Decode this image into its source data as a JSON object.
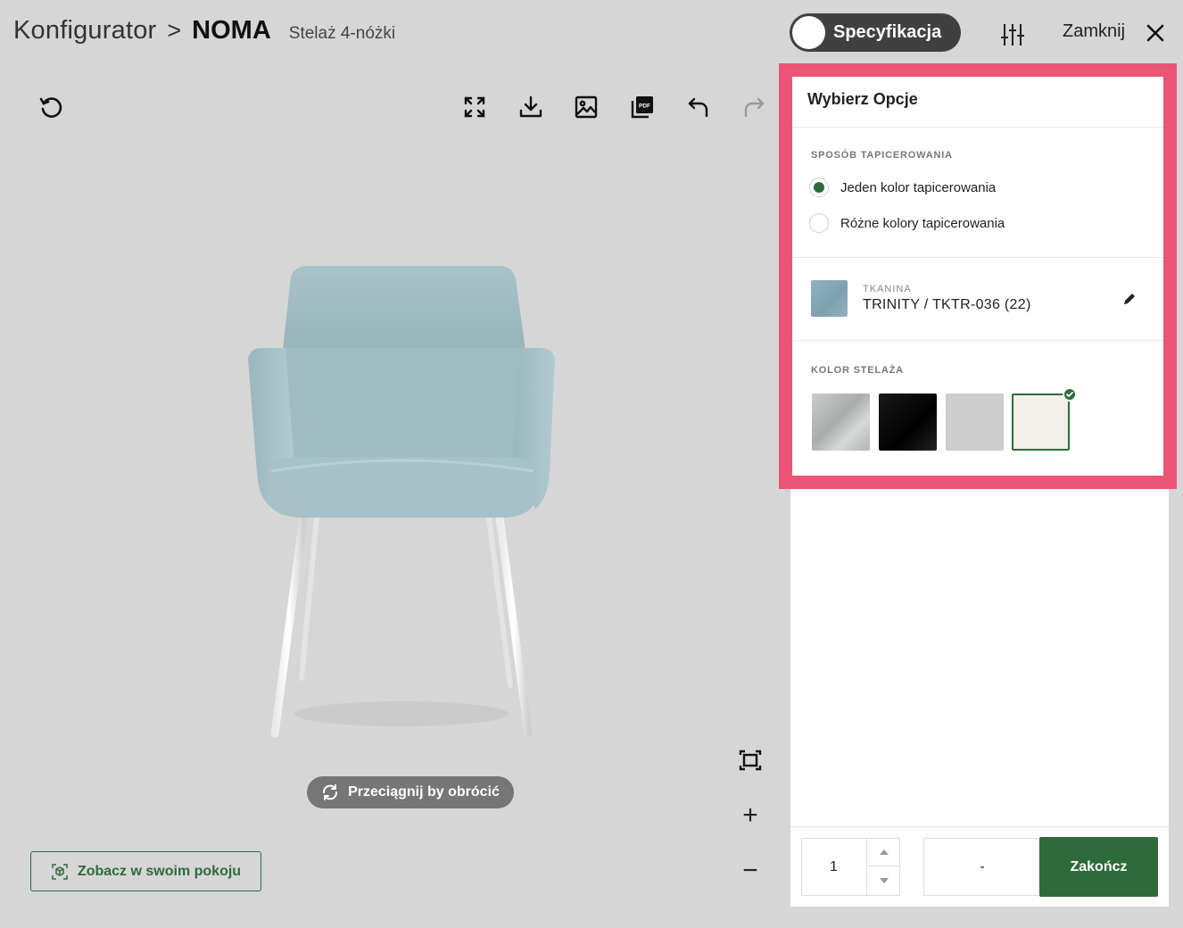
{
  "header": {
    "breadcrumb": "Konfigurator",
    "separator": ">",
    "product": "NOMA",
    "subtitle": "Stelaż 4-nóżki",
    "spec_toggle_label": "Specyfikacja",
    "close_label": "Zamknij"
  },
  "toolbar": {
    "icons": [
      "reset-view-icon",
      "fullscreen-icon",
      "download-icon",
      "image-icon",
      "pdf-icon",
      "undo-icon",
      "redo-icon"
    ]
  },
  "viewer": {
    "drag_hint": "Przeciągnij by obrócić",
    "ar_button": "Zobacz w swoim pokoju",
    "zoom_in": "+",
    "zoom_out": "−"
  },
  "panel": {
    "title": "Wybierz Opcje",
    "upholstery": {
      "label": "SPOSÓB TAPICEROWANIA",
      "options": [
        {
          "label": "Jeden kolor tapicerowania",
          "selected": true
        },
        {
          "label": "Różne kolory tapicerowania",
          "selected": false
        }
      ]
    },
    "fabric": {
      "label": "TKANINA",
      "name": "TRINITY / TKTR-036 (22)",
      "color": "#87a8b8"
    },
    "frame": {
      "label": "KOLOR STELAŻA",
      "swatches": [
        {
          "color": "#b9bcba",
          "selected": false
        },
        {
          "color": "#0c0c0c",
          "selected": false
        },
        {
          "color": "#cdcdcd",
          "selected": false
        },
        {
          "color": "#f1efe9",
          "selected": true
        }
      ]
    }
  },
  "footer": {
    "quantity": "1",
    "price": "-",
    "finish_button": "Zakończ"
  },
  "colors": {
    "accent_green": "#2e6b3a",
    "highlight_border": "#ea5574",
    "toggle_bg": "#404040"
  }
}
